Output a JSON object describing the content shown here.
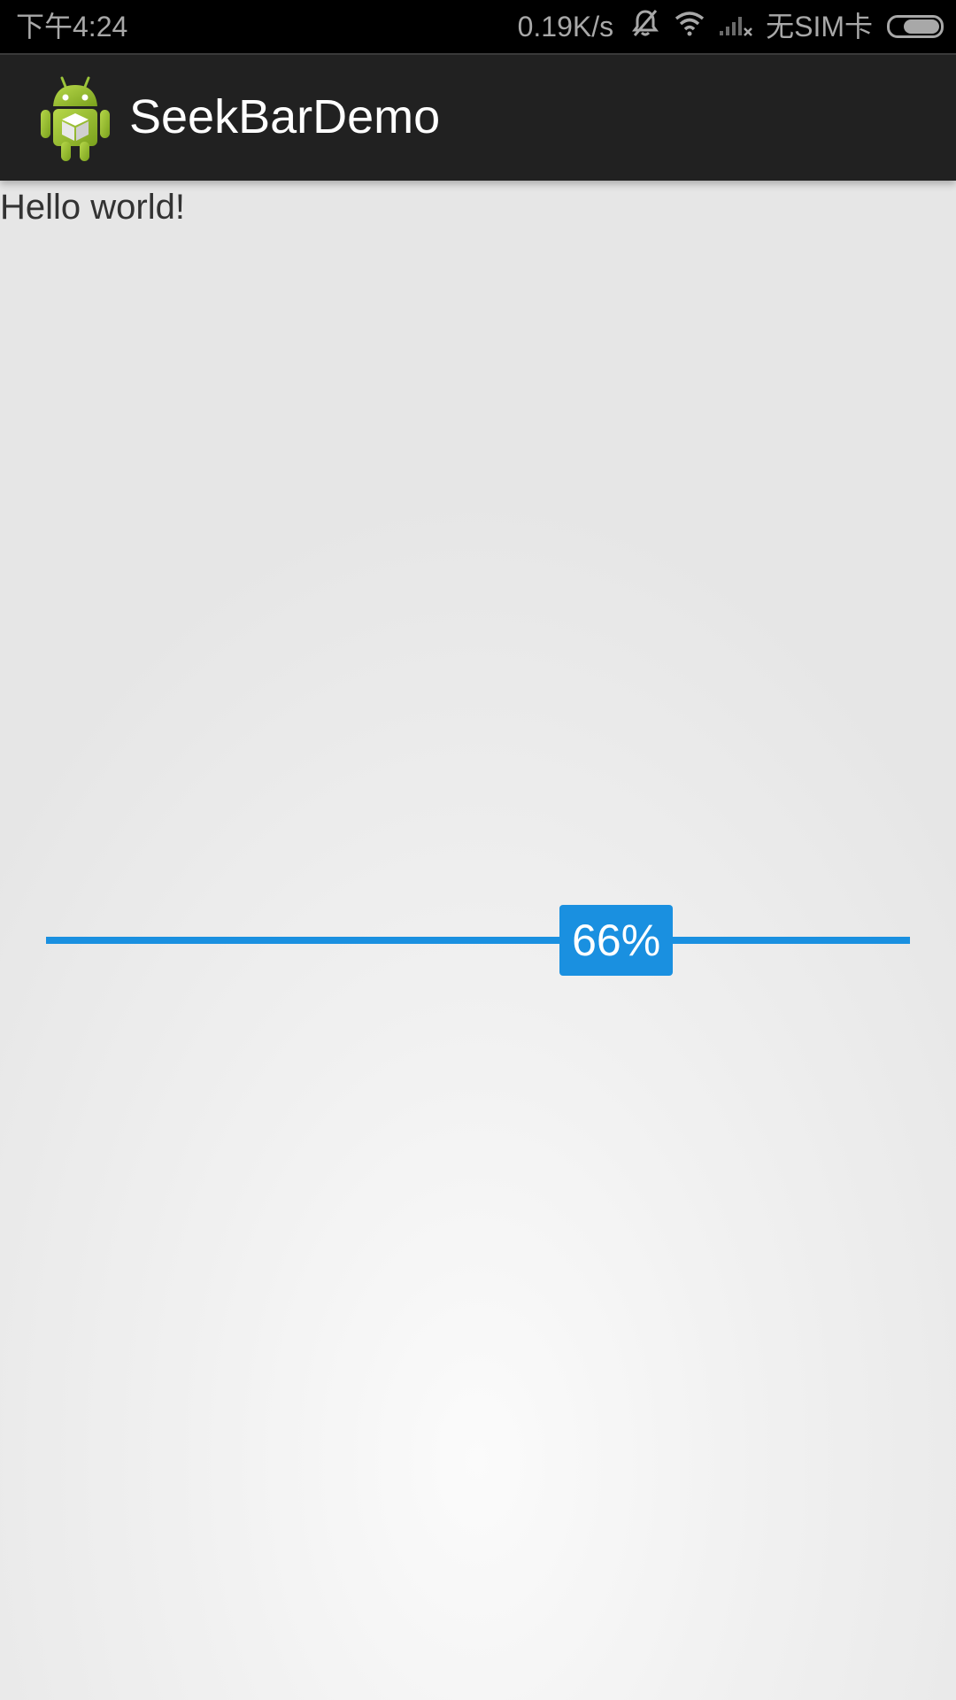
{
  "status_bar": {
    "time": "下午4:24",
    "network_speed": "0.19K/s",
    "sim_status": "无SIM卡",
    "icons": [
      "muted-bell-icon",
      "wifi-icon",
      "no-signal-icon",
      "battery-icon"
    ],
    "battery_level": 0.75
  },
  "action_bar": {
    "title": "SeekBarDemo",
    "icon": "android-app-icon"
  },
  "content": {
    "hello_text": "Hello world!"
  },
  "seekbar": {
    "value": 66,
    "max": 100,
    "label": "66%",
    "color": "#1a90e0"
  }
}
